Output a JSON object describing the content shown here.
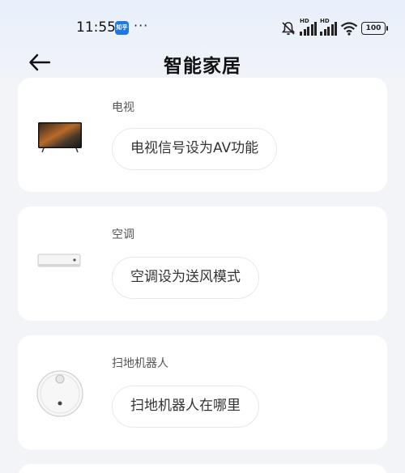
{
  "status_bar": {
    "time": "11:55",
    "app_badge": "知乎",
    "overflow": "···",
    "hd1": "HD",
    "hd2": "HD",
    "battery": "100"
  },
  "header": {
    "title": "智能家居"
  },
  "devices": [
    {
      "name": "电视",
      "command": "电视信号设为AV功能",
      "icon": "tv-image"
    },
    {
      "name": "空调",
      "command": "空调设为送风模式",
      "icon": "air-conditioner-image"
    },
    {
      "name": "扫地机器人",
      "command": "扫地机器人在哪里",
      "icon": "robot-vacuum-image"
    }
  ],
  "colors": {
    "accent_badge": "#1f7ae0",
    "page_bg": "#f3f4f8",
    "card_bg": "#ffffff"
  }
}
